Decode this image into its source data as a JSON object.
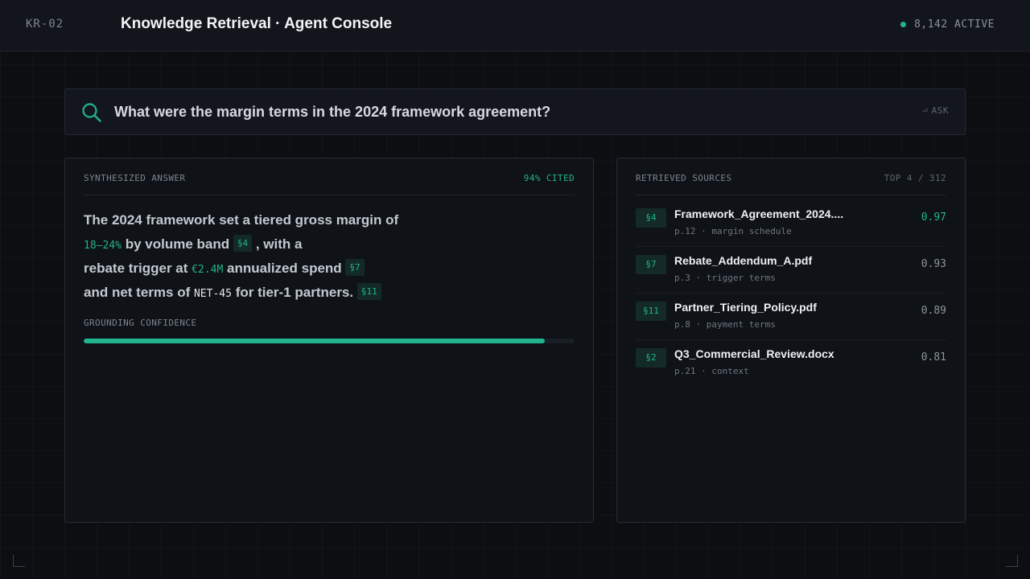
{
  "header": {
    "station_id": "KR-02",
    "title": "Knowledge Retrieval · Agent Console",
    "status_text": "8,142 ACTIVE",
    "status_color": "#22b48c"
  },
  "search": {
    "query": "What were the margin terms in the 2024 framework agreement?",
    "icon": "search-icon",
    "ask_icon": "enter-icon",
    "ask_glyph": "⏎",
    "ask_label": "ASK"
  },
  "answer": {
    "label": "SYNTHESIZED ANSWER",
    "cited": "94% CITED",
    "lines": [
      {
        "t1": "The 2024 framework set a tiered gross margin of"
      },
      {
        "hl": "18–24%",
        "t1": "by volume band",
        "cite": "§4",
        "t2": ", with a"
      },
      {
        "t1": "rebate trigger at",
        "hl": "€2.4M",
        "t2": "annualized spend",
        "cite": "§7"
      },
      {
        "t1": "and net terms of",
        "code": "NET-45",
        "t2": "for tier-1 partners.",
        "cite": "§11"
      }
    ],
    "confidence_label": "GROUNDING CONFIDENCE",
    "confidence": 0.94
  },
  "sources": {
    "label": "RETRIEVED SOURCES",
    "count": "TOP 4 / 312",
    "items": [
      {
        "tag": "§4",
        "name": "Framework_Agreement_2024....",
        "meta": "p.12 · margin schedule",
        "score": "0.97"
      },
      {
        "tag": "§7",
        "name": "Rebate_Addendum_A.pdf",
        "meta": "p.3 · trigger terms",
        "score": "0.93"
      },
      {
        "tag": "§11",
        "name": "Partner_Tiering_Policy.pdf",
        "meta": "p.8 · payment terms",
        "score": "0.89"
      },
      {
        "tag": "§2",
        "name": "Q3_Commercial_Review.docx",
        "meta": "p.21 · context",
        "score": "0.81"
      }
    ]
  },
  "colors": {
    "accent": "#22b48c",
    "background": "#0c0e12",
    "panel": "#0f1217"
  }
}
